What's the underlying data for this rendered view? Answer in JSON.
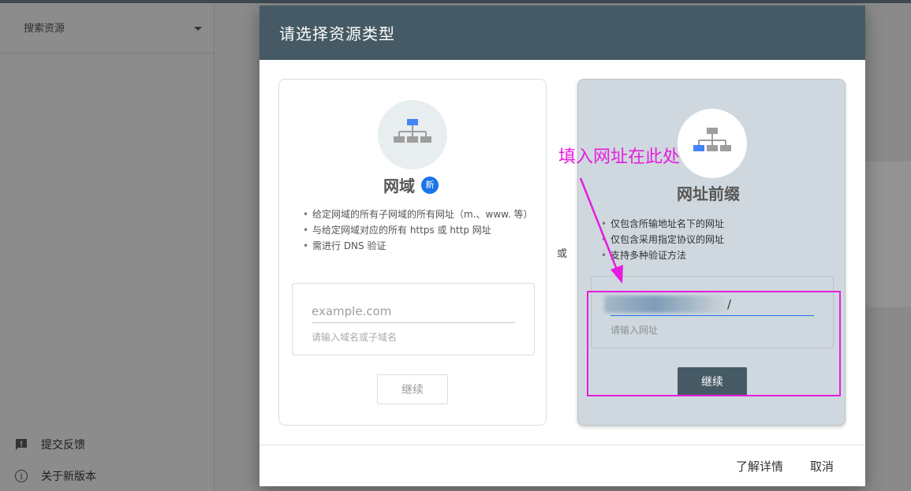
{
  "background": {
    "sidebar": {
      "search_label": "搜索资源",
      "feedback_label": "提交反馈",
      "new_version_label": "关于新版本"
    }
  },
  "dialog": {
    "title": "请选择资源类型",
    "or_label": "或",
    "domain_card": {
      "title": "网域",
      "badge": "新",
      "bullets": [
        "给定网域的所有子网域的所有网址（m.、www. 等）",
        "与给定网域对应的所有 https 或 http 网址",
        "需进行 DNS 验证"
      ],
      "input_placeholder": "example.com",
      "input_hint": "请输入域名或子域名",
      "continue_label": "继续"
    },
    "prefix_card": {
      "title": "网址前缀",
      "bullets": [
        "仅包含所输地址名下的网址",
        "仅包含采用指定协议的网址",
        "支持多种验证方法"
      ],
      "input_suffix": "/",
      "input_hint": "请输入网址",
      "continue_label": "继续"
    },
    "footer": {
      "learn_more": "了解详情",
      "cancel": "取消"
    }
  },
  "annotation": {
    "text": "填入网址在此处",
    "color": "#e61ce0"
  },
  "colors": {
    "header": "#455a64",
    "accent": "#1a73e8"
  }
}
